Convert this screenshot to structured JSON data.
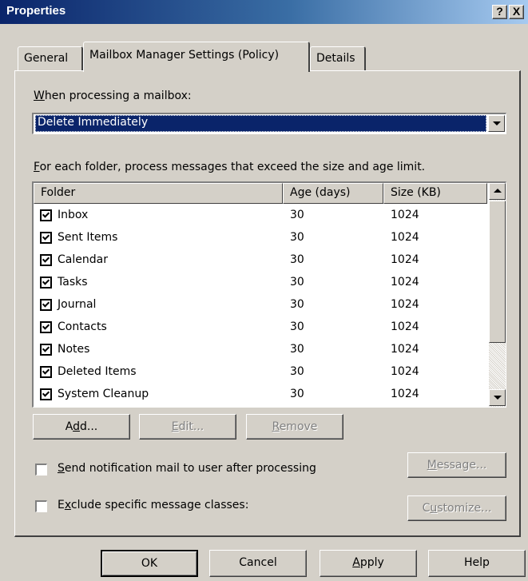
{
  "window": {
    "title": "Properties",
    "help_btn": "?",
    "close_btn": "X"
  },
  "tabs": [
    {
      "label": "General",
      "active": false
    },
    {
      "label": "Mailbox Manager Settings (Policy)",
      "active": true
    },
    {
      "label": "Details",
      "active": false
    }
  ],
  "processing": {
    "label_u": "W",
    "label_rest": "hen processing a mailbox:",
    "selected": "Delete Immediately"
  },
  "folder_section": {
    "label_u": "F",
    "label_rest": "or each folder, process messages that exceed the size and age limit."
  },
  "table": {
    "columns": [
      "Folder",
      "Age (days)",
      "Size (KB)"
    ],
    "rows": [
      {
        "folder": "Inbox",
        "age": "30",
        "size": "1024",
        "checked": true
      },
      {
        "folder": "Sent Items",
        "age": "30",
        "size": "1024",
        "checked": true
      },
      {
        "folder": "Calendar",
        "age": "30",
        "size": "1024",
        "checked": true
      },
      {
        "folder": "Tasks",
        "age": "30",
        "size": "1024",
        "checked": true
      },
      {
        "folder": "Journal",
        "age": "30",
        "size": "1024",
        "checked": true
      },
      {
        "folder": "Contacts",
        "age": "30",
        "size": "1024",
        "checked": true
      },
      {
        "folder": "Notes",
        "age": "30",
        "size": "1024",
        "checked": true
      },
      {
        "folder": "Deleted Items",
        "age": "30",
        "size": "1024",
        "checked": true
      },
      {
        "folder": "System Cleanup",
        "age": "30",
        "size": "1024",
        "checked": true
      }
    ]
  },
  "list_buttons": {
    "add_pre": "A",
    "add_u": "d",
    "add_post": "d...",
    "edit_u": "E",
    "edit_post": "dit...",
    "remove_u": "R",
    "remove_post": "emove"
  },
  "options": {
    "notify_u": "S",
    "notify_rest": "end notification mail to user after processing",
    "notify_checked": false,
    "exclude_pre": "E",
    "exclude_u": "x",
    "exclude_rest": "clude specific message classes:",
    "exclude_checked": false,
    "message_u": "M",
    "message_rest": "essage...",
    "customize_pre": "C",
    "customize_u": "u",
    "customize_rest": "stomize..."
  },
  "dialog_buttons": {
    "ok": "OK",
    "cancel": "Cancel",
    "apply_u": "A",
    "apply_rest": "pply",
    "help": "Help"
  }
}
